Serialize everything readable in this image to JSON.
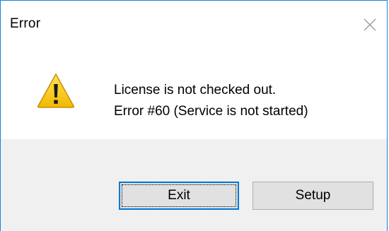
{
  "dialog": {
    "title": "Error",
    "close_icon": "close-icon",
    "message_lines": [
      "License is not checked out.",
      "Error #60 (Service is not started)"
    ],
    "icon": "warning-icon",
    "buttons": {
      "exit_label": "Exit",
      "setup_label": "Setup"
    }
  },
  "colors": {
    "window_border": "#1883d7",
    "footer_background": "#f0f0f0",
    "default_button_border": "#0078d7",
    "button_face": "#e1e1e1",
    "warning_yellow": "#f5c400"
  }
}
